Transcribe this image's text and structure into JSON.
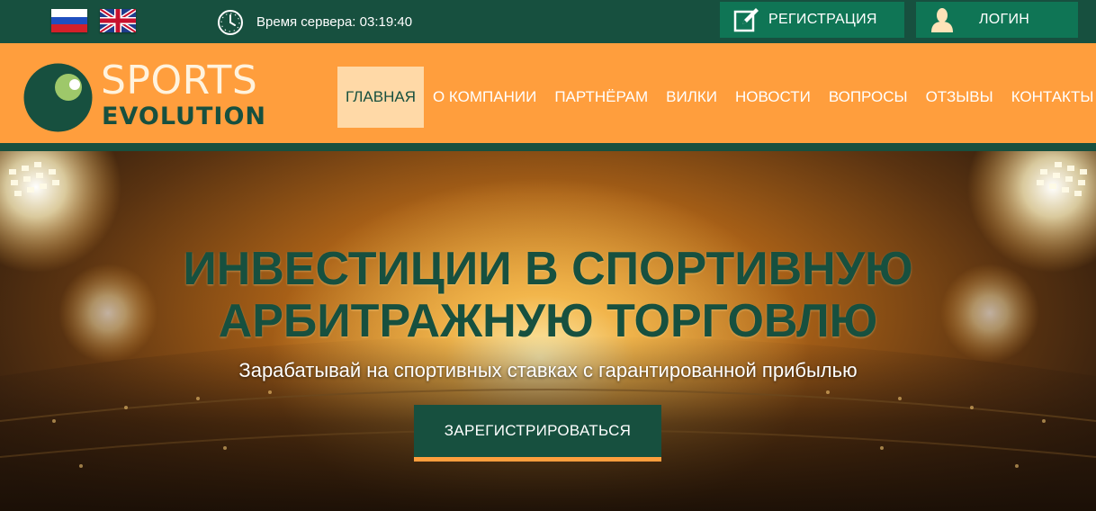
{
  "topbar": {
    "languages": [
      {
        "code": "ru",
        "icon": "russia-flag-icon"
      },
      {
        "code": "en",
        "icon": "uk-flag-icon"
      }
    ],
    "server_time_label": "Время сервера:",
    "server_time_value": "03:19:40",
    "register_label": "РЕГИСТРАЦИЯ",
    "login_label": "ЛОГИН"
  },
  "logo": {
    "line1": "SPORTS",
    "line2": "EVOLUTION"
  },
  "nav": {
    "items": [
      {
        "label": "ГЛАВНАЯ",
        "active": true
      },
      {
        "label": "О КОМПАНИИ"
      },
      {
        "label": "ПАРТНЁРАМ"
      },
      {
        "label": "ВИЛКИ"
      },
      {
        "label": "НОВОСТИ"
      },
      {
        "label": "ВОПРОСЫ"
      },
      {
        "label": "ОТЗЫВЫ"
      },
      {
        "label": "КОНТАКТЫ"
      }
    ]
  },
  "hero": {
    "title_line1": "ИНВЕСТИЦИИ В СПОРТИВНУЮ",
    "title_line2": "АРБИТРАЖНУЮ ТОРГОВЛЮ",
    "subtitle": "Зарабатывай на спортивных ставках с гарантированной прибылью",
    "cta_label": "ЗАРЕГИСТРИРОВАТЬСЯ"
  },
  "colors": {
    "dark_green": "#17503f",
    "button_green": "#0f7555",
    "orange": "#ff9e3d",
    "active_nav_bg": "#ffd9a7"
  }
}
